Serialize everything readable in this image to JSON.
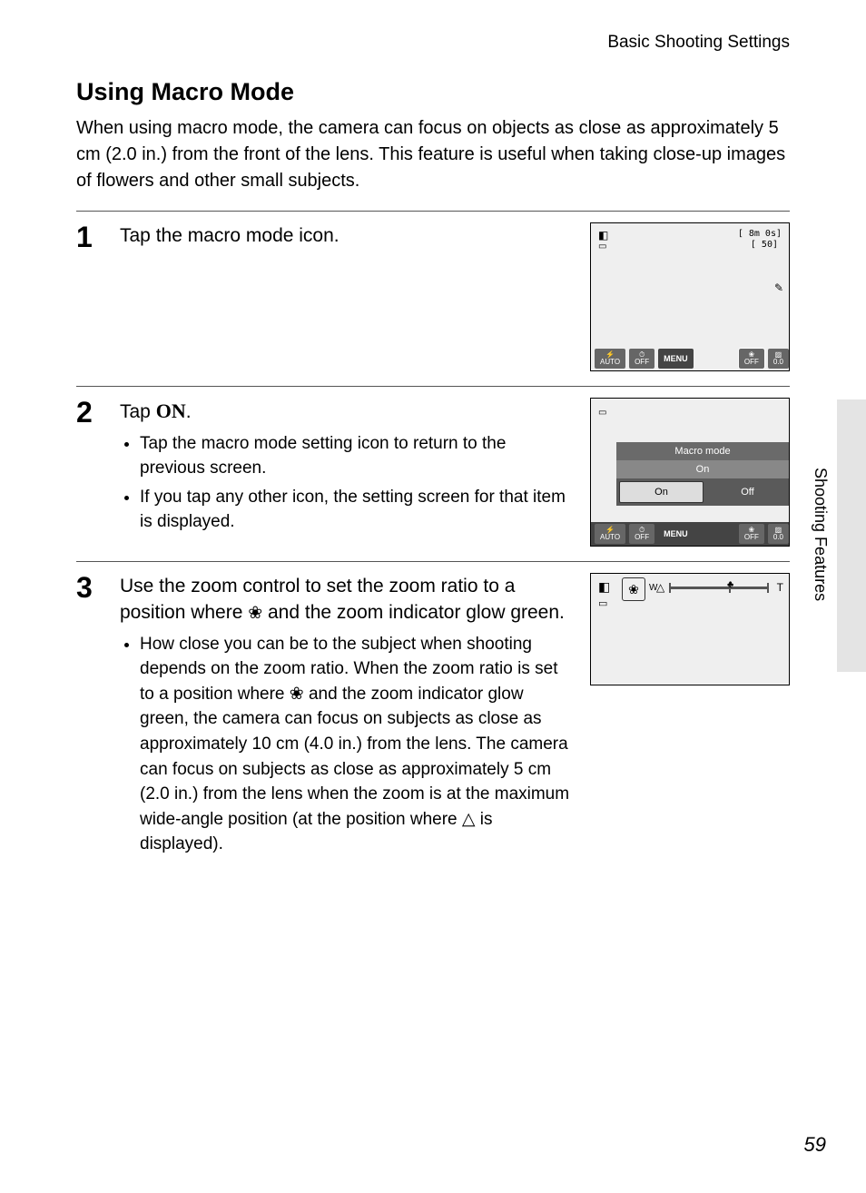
{
  "header": {
    "breadcrumb": "Basic Shooting Settings"
  },
  "title": "Using Macro Mode",
  "intro": "When using macro mode, the camera can focus on objects as close as approximately 5 cm (2.0 in.) from the front of the lens. This feature is useful when taking close-up images of flowers and other small subjects.",
  "steps": {
    "s1": {
      "num": "1",
      "text": "Tap the macro mode icon."
    },
    "s2": {
      "num": "2",
      "prefix": "Tap ",
      "on": "ON",
      "suffix": ".",
      "b1": "Tap the macro mode setting icon to return to the previous screen.",
      "b2": "If you tap any other icon, the setting screen for that item is displayed."
    },
    "s3": {
      "num": "3",
      "l1a": "Use the zoom control to set the zoom ratio to a position where ",
      "l1b": " and the zoom indicator glow green.",
      "b1a": "How close you can be to the subject when shooting depends on the zoom ratio. When the zoom ratio is set to a position where ",
      "b1b": " and the zoom indicator glow green, the camera can focus on subjects as close as approximately 10 cm (4.0 in.) from the lens. The camera can focus on subjects as close as approximately 5 cm (2.0 in.) from the lens when the zoom is at the maximum wide-angle position (at the position where ",
      "b1c": " is displayed)."
    }
  },
  "screens": {
    "s1": {
      "tr1": "[   8m 0s]",
      "tr2": "[    50]",
      "bar": {
        "c1a": "⚡",
        "c1b": "AUTO",
        "c2a": "⏱",
        "c2b": "OFF",
        "menu": "MENU",
        "c4a": "❀",
        "c4b": "OFF",
        "c5a": "▨",
        "c5b": "0.0"
      }
    },
    "s2": {
      "title": "Macro mode",
      "current": "On",
      "optOn": "On",
      "optOff": "Off",
      "bar": {
        "c1a": "⚡",
        "c1b": "AUTO",
        "c2a": "⏱",
        "c2b": "OFF",
        "menu": "MENU",
        "c4a": "❀",
        "c4b": "OFF",
        "c5a": "▨",
        "c5b": "0.0"
      }
    },
    "s3": {
      "W": "W",
      "T": "T"
    }
  },
  "side": {
    "label": "Shooting Features"
  },
  "page": "59",
  "glyph": {
    "flower": "❀",
    "mountain": "△"
  }
}
